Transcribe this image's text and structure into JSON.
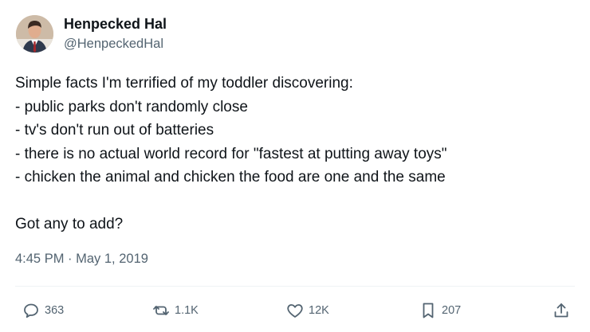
{
  "user": {
    "display_name": "Henpecked Hal",
    "handle": "@HenpeckedHal",
    "avatar_icon": "profile-photo"
  },
  "tweet": {
    "lines": [
      "Simple facts I'm terrified of my toddler discovering:",
      "- public parks don't randomly close",
      "- tv's don't run out of batteries",
      "- there is no actual world record for \"fastest at putting away toys\"",
      "- chicken the animal and chicken the food are one and the same",
      "Got any to add?"
    ],
    "timestamp": "4:45 PM · May 1, 2019"
  },
  "actions": {
    "replies": "363",
    "retweets": "1.1K",
    "likes": "12K",
    "bookmarks": "207",
    "icons": [
      "reply-icon",
      "retweet-icon",
      "like-icon",
      "bookmark-icon",
      "share-icon"
    ]
  },
  "colors": {
    "text": "#0f1419",
    "secondary": "#536471",
    "divider": "#eff3f4"
  }
}
